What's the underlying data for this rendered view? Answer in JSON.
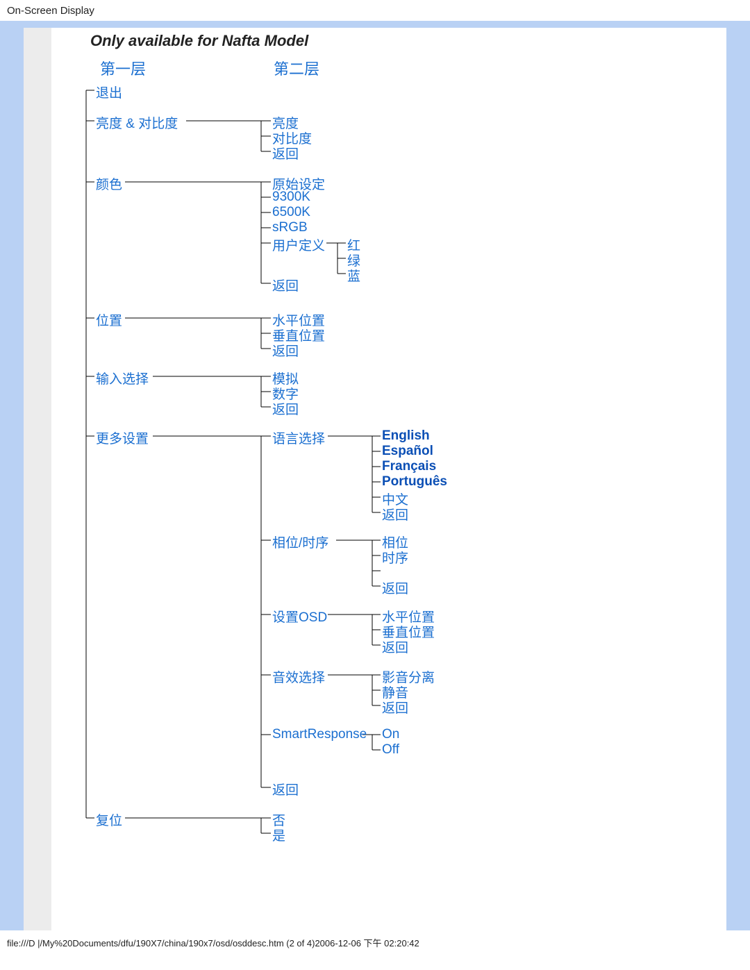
{
  "header": "On-Screen Display",
  "title": "Only available for Nafta Model",
  "col1": "第一层",
  "col2": "第二层",
  "exit": "退出",
  "bc": "亮度 & 对比度",
  "bc_brightness": "亮度",
  "bc_contrast": "对比度",
  "bc_return": "返回",
  "color": "颜色",
  "c_original": "原始设定",
  "c_9300": "9300K",
  "c_6500": "6500K",
  "c_srgb": "sRGB",
  "c_user": "用户定义",
  "c_user_r": "红",
  "c_user_g": "绿",
  "c_user_b": "蓝",
  "c_return": "返回",
  "position": "位置",
  "p_h": "水平位置",
  "p_v": "垂直位置",
  "p_return": "返回",
  "input": "输入选择",
  "in_analog": "模拟",
  "in_digital": "数字",
  "in_return": "返回",
  "more": "更多设置",
  "m_lang": "语言选择",
  "lang_en": "English",
  "lang_es": "Español",
  "lang_fr": "Français",
  "lang_pt": "Português",
  "lang_cn": "中文",
  "lang_return": "返回",
  "m_phase": "相位/时序",
  "ph_phase": "相位",
  "ph_clock": "时序",
  "ph_return": "返回",
  "m_osd": "设置OSD",
  "osd_h": "水平位置",
  "osd_v": "垂直位置",
  "osd_return": "返回",
  "m_audio": "音效选择",
  "au_standalone": "影音分离",
  "au_mute": "静音",
  "au_return": "返回",
  "m_sr": "SmartResponse",
  "sr_on": "On",
  "sr_off": "Off",
  "m_return": "返回",
  "reset": "复位",
  "r_no": "否",
  "r_yes": "是",
  "footer": "file:///D |/My%20Documents/dfu/190X7/china/190x7/osd/osddesc.htm (2 of 4)2006-12-06 下午 02:20:42"
}
